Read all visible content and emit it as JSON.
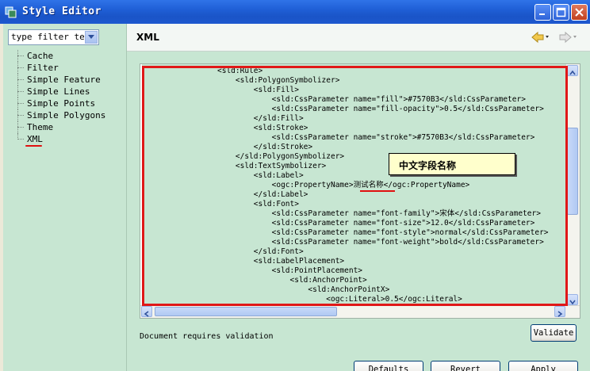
{
  "window": {
    "title": "Style Editor"
  },
  "left": {
    "filter_value": "type filter tex",
    "tree": [
      "Cache",
      "Filter",
      "Simple Feature",
      "Simple Lines",
      "Simple Points",
      "Simple Polygons",
      "Theme",
      "XML"
    ],
    "selected": "XML"
  },
  "header": {
    "title": "XML"
  },
  "editor": {
    "lines": [
      "<sld:Rule>",
      "    <sld:PolygonSymbolizer>",
      "        <sld:Fill>",
      "            <sld:CssParameter name=\"fill\">#7570B3</sld:CssParameter>",
      "            <sld:CssParameter name=\"fill-opacity\">0.5</sld:CssParameter>",
      "        </sld:Fill>",
      "        <sld:Stroke>",
      "            <sld:CssParameter name=\"stroke\">#7570B3</sld:CssParameter>",
      "        </sld:Stroke>",
      "    </sld:PolygonSymbolizer>",
      "    <sld:TextSymbolizer>",
      "        <sld:Label>",
      "            <ogc:PropertyName>测试名称</ogc:PropertyName>",
      "        </sld:Label>",
      "        <sld:Font>",
      "            <sld:CssParameter name=\"font-family\">宋体</sld:CssParameter>",
      "            <sld:CssParameter name=\"font-size\">12.0</sld:CssParameter>",
      "            <sld:CssParameter name=\"font-style\">normal</sld:CssParameter>",
      "            <sld:CssParameter name=\"font-weight\">bold</sld:CssParameter>",
      "        </sld:Font>",
      "        <sld:LabelPlacement>",
      "            <sld:PointPlacement>",
      "                <sld:AnchorPoint>",
      "                    <sld:AnchorPointX>",
      "                        <ogc:Literal>0.5</ogc:Literal>"
    ]
  },
  "callout": {
    "text": "中文字段名称"
  },
  "status": {
    "text": "Document requires validation"
  },
  "buttons": {
    "validate": "Validate",
    "defaults": "Defaults",
    "revert": "Revert",
    "apply": "Apply"
  },
  "colors": {
    "accent_red": "#e01818",
    "pane_green": "#c7e6d2",
    "titlebar_blue": "#1f5fd6"
  }
}
